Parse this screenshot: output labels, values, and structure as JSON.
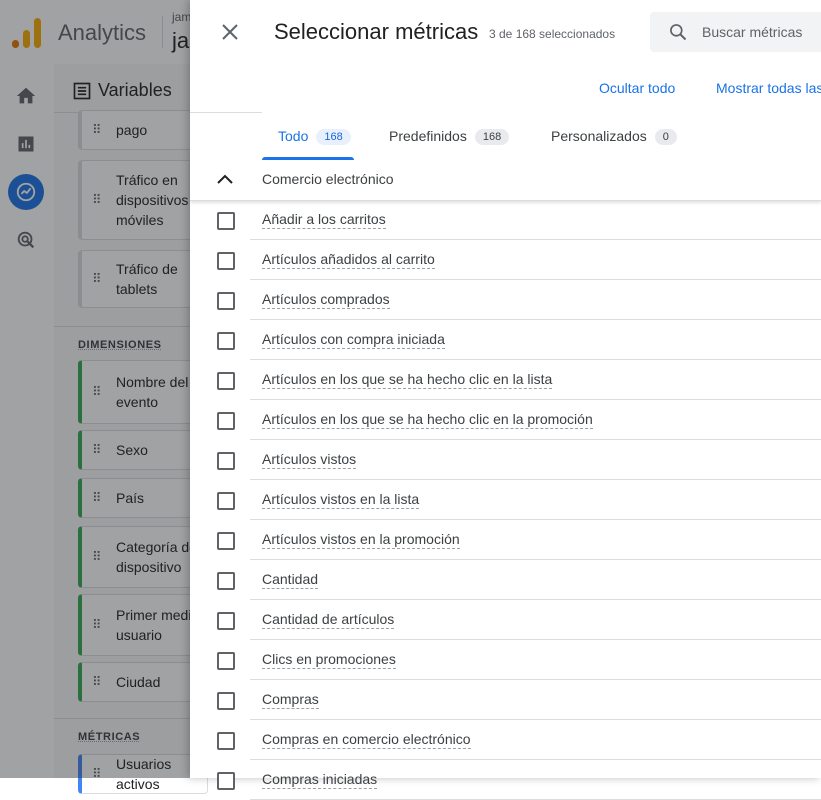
{
  "app": {
    "name": "Analytics",
    "account_small": "jam",
    "account_big": "ja"
  },
  "variables": {
    "title": "Variables",
    "chips_top": [
      {
        "label": "pago"
      },
      {
        "label": "Tráfico en\ndispositivos\nmóviles"
      },
      {
        "label": "Tráfico de\ntablets"
      }
    ],
    "dimensions_label": "DIMENSIONES",
    "dimensions": [
      {
        "label": "Nombre del\nevento"
      },
      {
        "label": "Sexo"
      },
      {
        "label": "País"
      },
      {
        "label": "Categoría de\ndispositivo"
      },
      {
        "label": "Primer medio\nusuario"
      },
      {
        "label": "Ciudad"
      }
    ],
    "metrics_label": "MÉTRICAS",
    "metrics": [
      {
        "label": "Usuarios activos"
      }
    ]
  },
  "drawer": {
    "title": "Seleccionar métricas",
    "selected_count": "3 de 168 seleccionados",
    "search_placeholder": "Buscar métricas",
    "hide_all": "Ocultar todo",
    "show_all": "Mostrar todas las",
    "tabs": [
      {
        "label": "Todo",
        "count": "168",
        "active": true
      },
      {
        "label": "Predefinidos",
        "count": "168",
        "active": false
      },
      {
        "label": "Personalizados",
        "count": "0",
        "active": false
      }
    ],
    "group_title": "Comercio electrónico",
    "items": [
      {
        "label": "Añadir a los carritos",
        "checked": false
      },
      {
        "label": "Artículos añadidos al carrito",
        "checked": false
      },
      {
        "label": "Artículos comprados",
        "checked": false
      },
      {
        "label": "Artículos con compra iniciada",
        "checked": false
      },
      {
        "label": "Artículos en los que se ha hecho clic en la lista",
        "checked": false
      },
      {
        "label": "Artículos en los que se ha hecho clic en la promoción",
        "checked": false
      },
      {
        "label": "Artículos vistos",
        "checked": false
      },
      {
        "label": "Artículos vistos en la lista",
        "checked": false
      },
      {
        "label": "Artículos vistos en la promoción",
        "checked": false
      },
      {
        "label": "Cantidad",
        "checked": false
      },
      {
        "label": "Cantidad de artículos",
        "checked": false
      },
      {
        "label": "Clics en promociones",
        "checked": false
      },
      {
        "label": "Compras",
        "checked": false
      },
      {
        "label": "Compras en comercio electrónico",
        "checked": false
      },
      {
        "label": "Compras iniciadas",
        "checked": false
      }
    ]
  },
  "colors": {
    "accent": "#1a73e8",
    "logo": [
      "#f9ab00",
      "#e37400"
    ],
    "dimension_chip": "#34a853",
    "metric_chip": "#4285f4"
  },
  "icons": {
    "close": "close-icon",
    "search": "search-icon",
    "collapse": "chevron-up-icon",
    "variables": "list-icon",
    "drag": "drag-handle-icon",
    "rail": [
      "home-icon",
      "reports-icon",
      "explore-icon",
      "advertising-icon"
    ]
  }
}
